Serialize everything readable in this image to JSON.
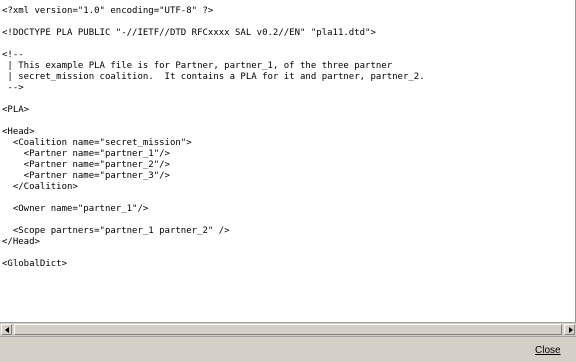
{
  "viewer": {
    "lines": [
      "<?xml version=\"1.0\" encoding=\"UTF-8\" ?>",
      "",
      "<!DOCTYPE PLA PUBLIC \"-//IETF//DTD RFCxxxx SAL v0.2//EN\" \"pla11.dtd\">",
      "",
      "<!--",
      " | This example PLA file is for Partner, partner_1, of the three partner",
      " | secret_mission coalition.  It contains a PLA for it and partner, partner_2.",
      " -->",
      "",
      "<PLA>",
      "",
      "<Head>",
      "  <Coalition name=\"secret_mission\">",
      "    <Partner name=\"partner_1\"/>",
      "    <Partner name=\"partner_2\"/>",
      "    <Partner name=\"partner_3\"/>",
      "  </Coalition>",
      "",
      "  <Owner name=\"partner_1\"/>",
      "",
      "  <Scope partners=\"partner_1 partner_2\" />",
      "</Head>",
      "",
      "<GlobalDict>"
    ]
  },
  "buttons": {
    "close_label": "Close"
  }
}
